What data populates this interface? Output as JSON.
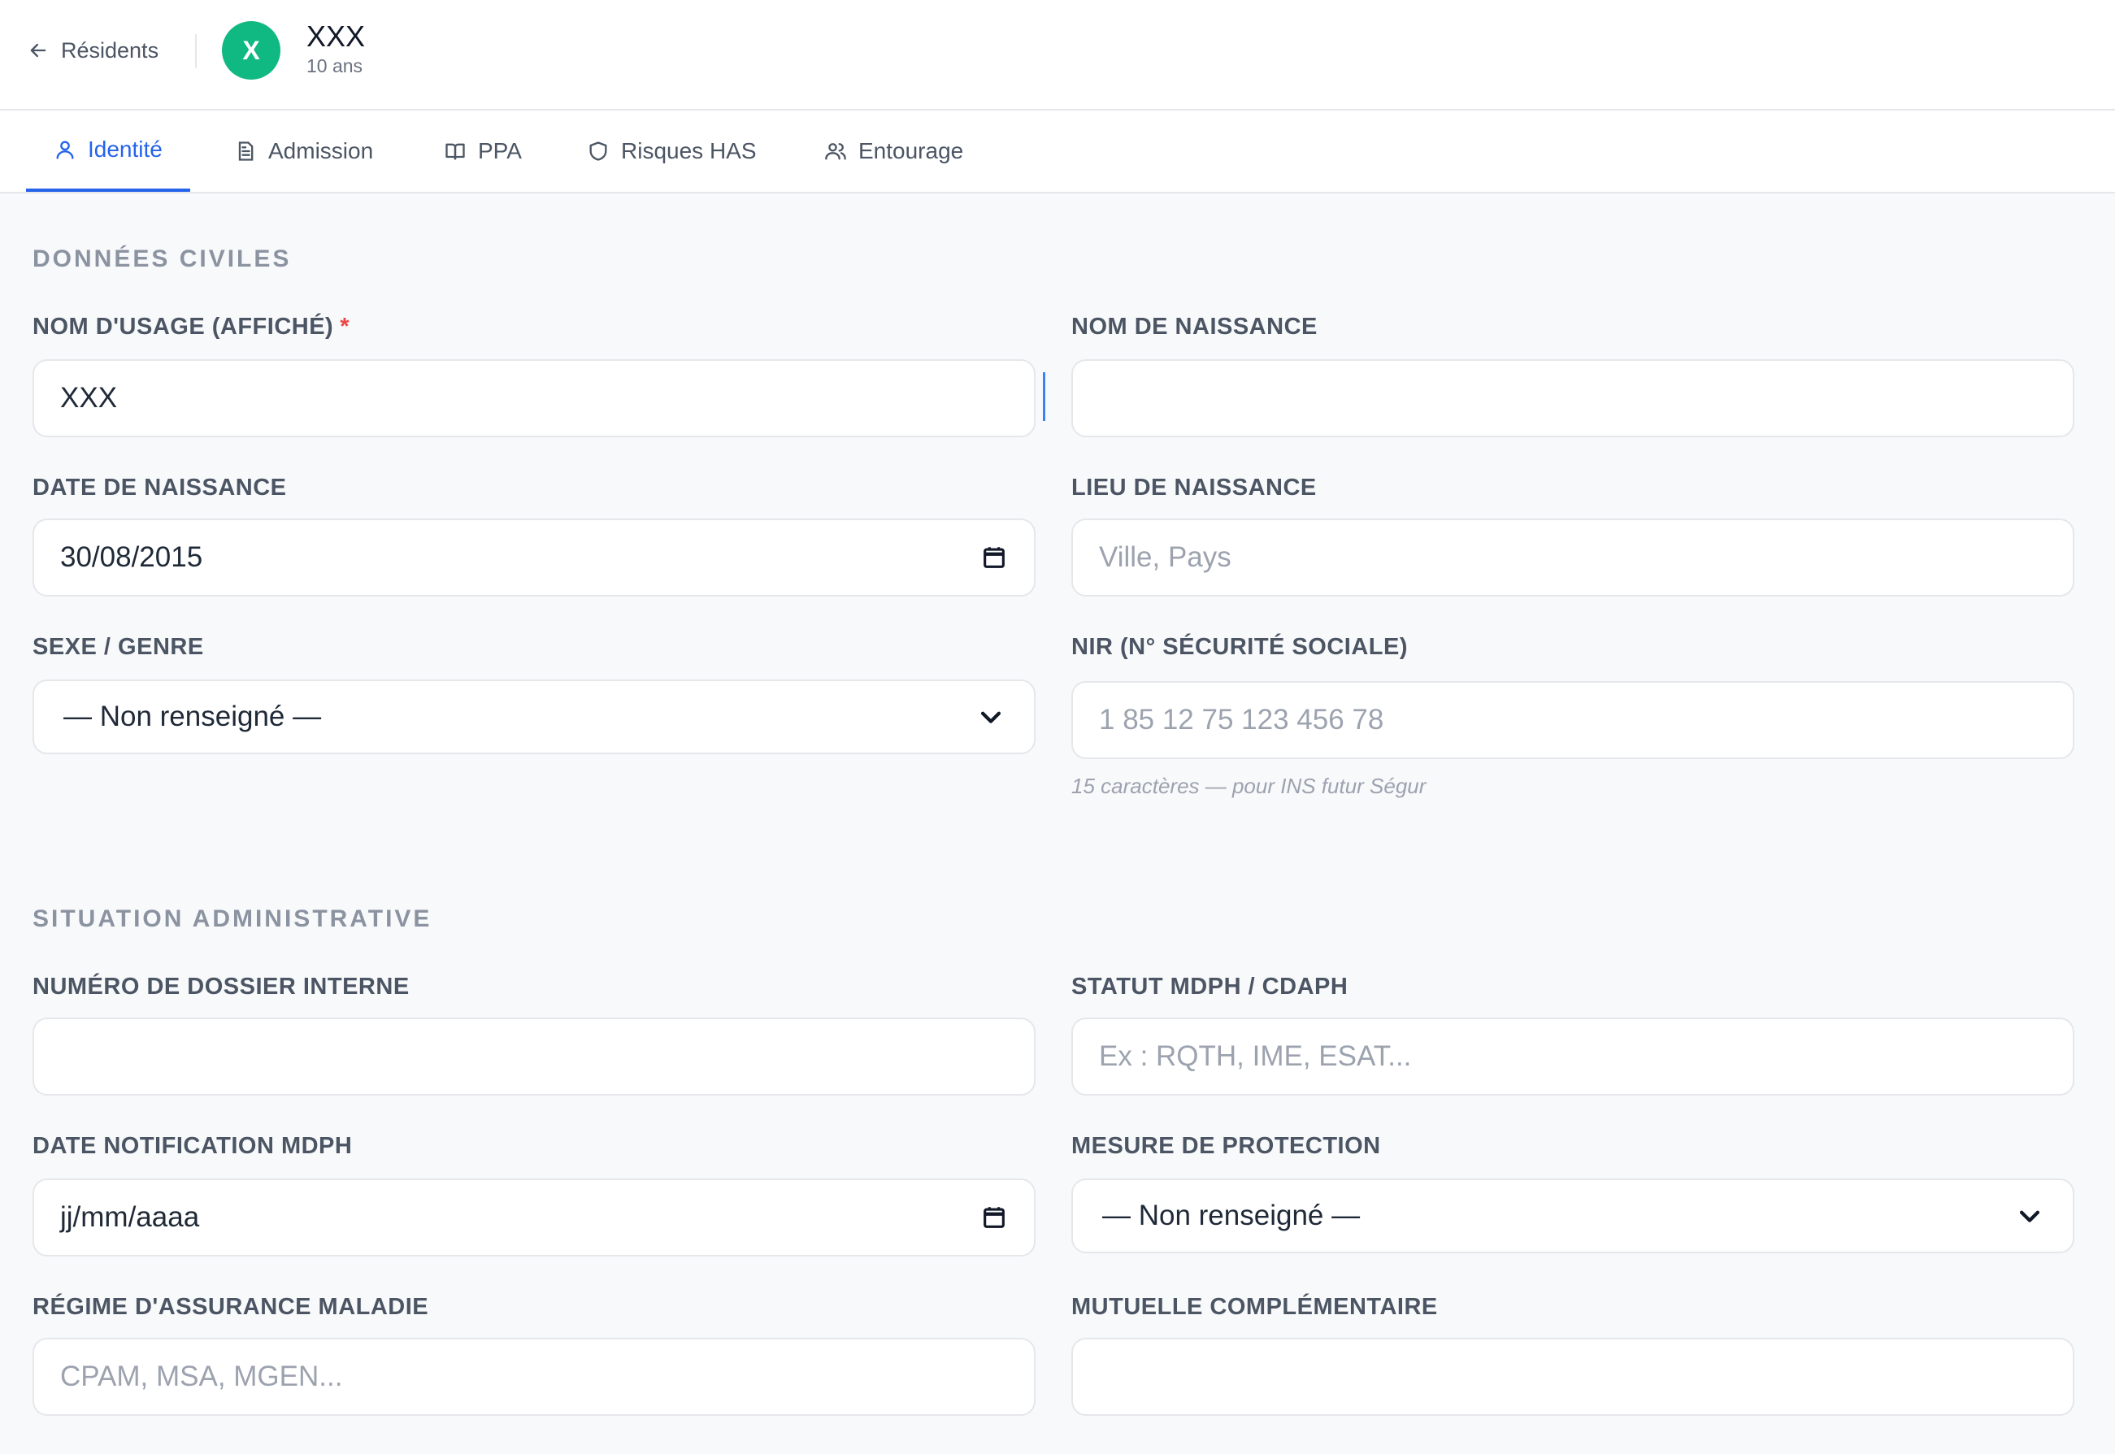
{
  "header": {
    "back_label": "Résidents",
    "avatar_initial": "X",
    "resident_name": "XXX",
    "resident_age": "10 ans"
  },
  "tabs": [
    {
      "label": "Identité",
      "icon": "user-icon",
      "active": true
    },
    {
      "label": "Admission",
      "icon": "document-icon",
      "active": false
    },
    {
      "label": "PPA",
      "icon": "book-icon",
      "active": false
    },
    {
      "label": "Risques HAS",
      "icon": "shield-icon",
      "active": false
    },
    {
      "label": "Entourage",
      "icon": "users-icon",
      "active": false
    }
  ],
  "civil": {
    "title": "DONNÉES CIVILES",
    "nom_usage": {
      "label": "NOM D'USAGE (AFFICHÉ)",
      "required": "*",
      "value": "XXX"
    },
    "nom_naissance": {
      "label": "NOM DE NAISSANCE",
      "value": ""
    },
    "date_naissance": {
      "label": "DATE DE NAISSANCE",
      "value": "30/08/2015"
    },
    "lieu_naissance": {
      "label": "LIEU DE NAISSANCE",
      "placeholder": "Ville, Pays"
    },
    "sexe": {
      "label": "SEXE / GENRE",
      "selected": "— Non renseigné —"
    },
    "nir": {
      "label": "NIR (N° SÉCURITÉ SOCIALE)",
      "placeholder": "1 85 12 75 123 456 78",
      "hint": "15 caractères — pour INS futur Ségur"
    }
  },
  "admin": {
    "title": "SITUATION ADMINISTRATIVE",
    "dossier": {
      "label": "NUMÉRO DE DOSSIER INTERNE",
      "value": ""
    },
    "mdph": {
      "label": "STATUT MDPH / CDAPH",
      "placeholder": "Ex : RQTH, IME, ESAT..."
    },
    "date_mdph": {
      "label": "DATE NOTIFICATION MDPH",
      "value": "jj/mm/aaaa"
    },
    "protection": {
      "label": "MESURE DE PROTECTION",
      "selected": "— Non renseigné —"
    },
    "regime": {
      "label": "RÉGIME D'ASSURANCE MALADIE",
      "placeholder": "CPAM, MSA, MGEN..."
    },
    "mutuelle": {
      "label": "MUTUELLE COMPLÉMENTAIRE",
      "value": ""
    }
  },
  "colors": {
    "accent": "#2563eb",
    "avatar": "#10b981",
    "required": "#ef4444"
  }
}
